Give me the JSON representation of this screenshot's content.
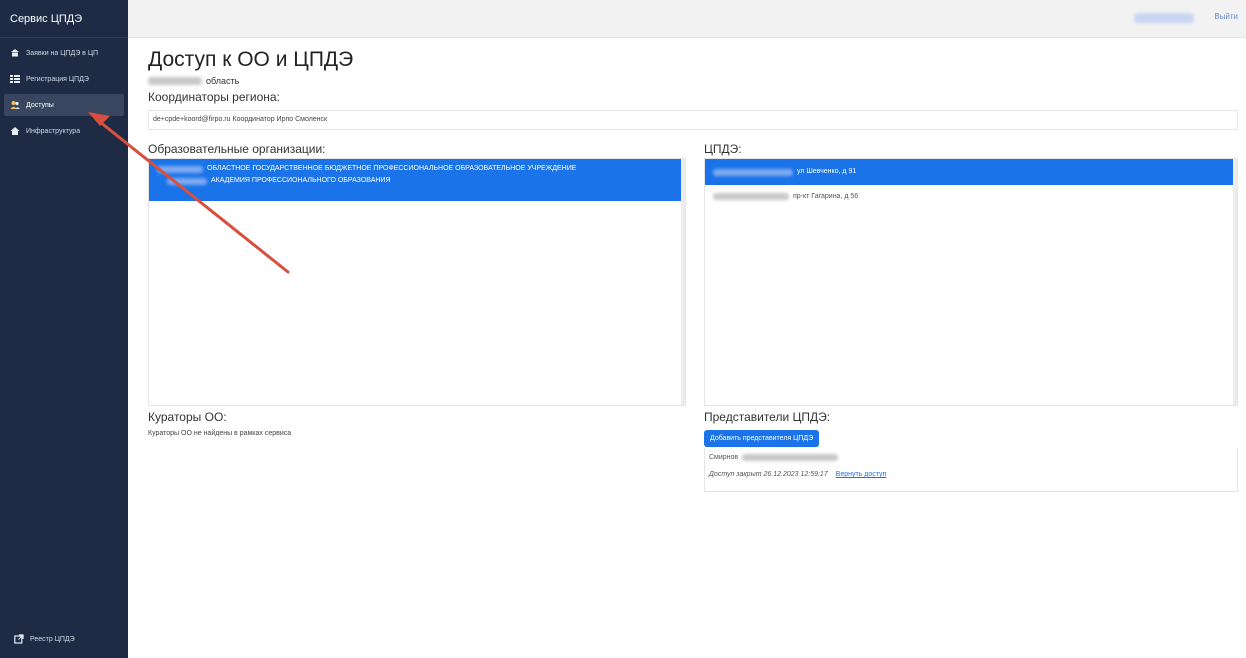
{
  "sidebar": {
    "brand": "Сервис ЦПДЭ",
    "items": [
      {
        "label": "Заявки на ЦПДЭ в ЦП",
        "icon": "building-icon"
      },
      {
        "label": "Регистрация ЦПДЭ",
        "icon": "list-icon"
      },
      {
        "label": "Доступы",
        "icon": "users-icon"
      },
      {
        "label": "Инфраструктура",
        "icon": "home-icon"
      }
    ],
    "bottom_item": {
      "label": "Реестр ЦПДЭ",
      "icon": "external-link-icon"
    },
    "active_index": 2
  },
  "topbar": {
    "exit_label": "Выйти"
  },
  "page": {
    "title": "Доступ к ОО и ЦПДЭ",
    "region_suffix": "область",
    "coordinators_title": "Координаторы региона:",
    "coordinator_line": "de+cpde+koord@firpo.ru Координатор Ирпо Смоленск"
  },
  "orgs": {
    "title": "Образовательные организации:",
    "selected_line1": "ОБЛАСТНОЕ ГОСУДАРСТВЕННОЕ БЮДЖЕТНОЕ ПРОФЕССИОНАЛЬНОЕ ОБРАЗОВАТЕЛЬНОЕ УЧРЕЖДЕНИЕ",
    "selected_line2": "АКАДЕМИЯ ПРОФЕССИОНАЛЬНОГО ОБРАЗОВАНИЯ"
  },
  "cpde": {
    "title": "ЦПДЭ:",
    "items": [
      {
        "address": "ул Шевченко, д 91",
        "selected": true
      },
      {
        "address": "пр-кт Гагарина, д 56",
        "selected": false
      }
    ]
  },
  "curators": {
    "title": "Кураторы ОО:",
    "empty_text": "Кураторы ОО не найдены в рамках сервиса"
  },
  "representatives": {
    "title": "Представители ЦПДЭ:",
    "add_button": "Добавить представителя ЦПДЭ",
    "person_surname": "Смирнов",
    "access_status": "Доступ закрыт 26.12.2023 12:59:17",
    "restore_link": "Вернуть доступ"
  },
  "colors": {
    "sidebar_bg": "#1f2a44",
    "accent": "#1a73e8",
    "arrow": "#d94f3d"
  }
}
